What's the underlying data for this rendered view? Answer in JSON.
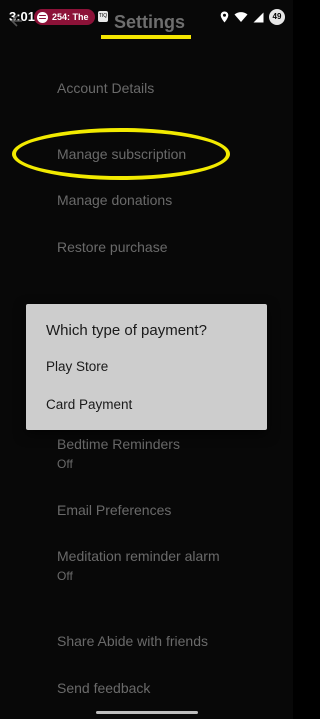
{
  "status_bar": {
    "time": "3:01",
    "notification_text": "254: The",
    "small_icon_label": "TIQ",
    "battery_level": "49"
  },
  "header": {
    "title": "Settings",
    "underline_color": "#f5e700"
  },
  "settings": {
    "account_details": "Account Details",
    "manage_subscription": "Manage subscription",
    "manage_donations": "Manage donations",
    "restore_purchase": "Restore purchase",
    "bedtime_reminders": "Bedtime Reminders",
    "bedtime_reminders_value": "Off",
    "email_preferences": "Email Preferences",
    "meditation_alarm": "Meditation reminder alarm",
    "meditation_alarm_value": "Off",
    "share": "Share Abide with friends",
    "feedback": "Send feedback"
  },
  "highlight_color": "#f2ea00",
  "dialog": {
    "title": "Which type of payment?",
    "options": [
      "Play Store",
      "Card Payment"
    ]
  },
  "icons": [
    "back-arrow-icon",
    "spotify-icon",
    "location-icon",
    "wifi-icon",
    "signal-icon",
    "battery-icon"
  ]
}
